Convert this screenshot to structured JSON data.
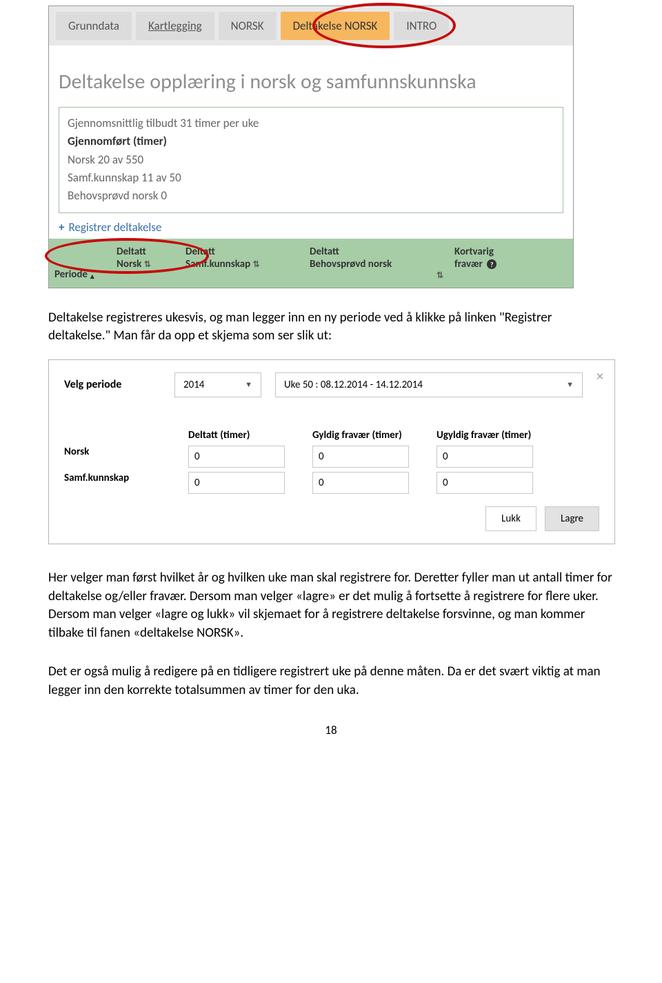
{
  "shot1": {
    "tabs": [
      "Grunndata",
      "Kartlegging",
      "NORSK",
      "Deltakelse NORSK",
      "INTRO"
    ],
    "title": "Deltakelse opplæring i norsk og samfunnskunnska",
    "stats": {
      "avg": "Gjennomsnittlig tilbudt 31 timer per uke",
      "section": "Gjennomført (timer)",
      "norsk": "Norsk 20 av 550",
      "samf": "Samf.kunnskap 11 av 50",
      "behov": "Behovsprøvd norsk 0"
    },
    "register_link": "Registrer deltakelse",
    "headers": {
      "periode": "Periode",
      "deltatt_norsk": [
        "Deltatt",
        "Norsk"
      ],
      "deltatt_samf": [
        "Deltatt",
        "Samf.kunnskap"
      ],
      "deltatt_behov": [
        "Deltatt",
        "Behovsprøvd norsk"
      ],
      "fravaer": [
        "Kortvarig",
        "fravær"
      ]
    }
  },
  "para1": "Deltakelse registreres ukesvis, og man legger inn en ny periode ved å klikke på linken \"Registrer deltakelse.\" Man får da opp et skjema som ser slik ut:",
  "shot2": {
    "velg_label": "Velg periode",
    "year": "2014",
    "week": "Uke 50 : 08.12.2014 - 14.12.2014",
    "cols": [
      "Deltatt (timer)",
      "Gyldig fravær (timer)",
      "Ugyldig fravær (timer)"
    ],
    "rows": [
      "Norsk",
      "Samf.kunnskap"
    ],
    "values": [
      [
        "0",
        "0",
        "0"
      ],
      [
        "0",
        "0",
        "0"
      ]
    ],
    "buttons": {
      "lukk": "Lukk",
      "lagre": "Lagre"
    }
  },
  "para2": "Her velger man først hvilket år og hvilken uke man skal registrere for. Deretter fyller man ut antall timer for deltakelse og/eller fravær. Dersom man velger «lagre» er det mulig å fortsette å registrere for flere uker. Dersom man velger «lagre og lukk» vil skjemaet for å registrere deltakelse forsvinne, og man kommer tilbake til fanen «deltakelse NORSK».",
  "para3": "Det er også mulig å redigere på en tidligere registrert uke på denne måten. Da er det svært viktig at man legger inn den korrekte totalsummen av timer for den uka.",
  "page_number": "18"
}
